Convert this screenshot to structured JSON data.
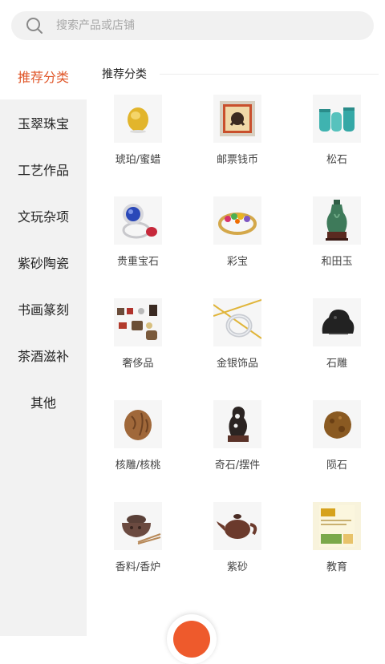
{
  "search": {
    "placeholder": "搜索产品或店铺"
  },
  "sidebar": {
    "active_color": "#e0572a",
    "items": [
      {
        "label": "推荐分类",
        "active": true
      },
      {
        "label": "玉翠珠宝"
      },
      {
        "label": "工艺作品"
      },
      {
        "label": "文玩杂项"
      },
      {
        "label": "紫砂陶瓷"
      },
      {
        "label": "书画篆刻"
      },
      {
        "label": "茶酒滋补"
      },
      {
        "label": "其他"
      }
    ]
  },
  "main": {
    "section_title": "推荐分类",
    "categories": [
      {
        "label": "琥珀/蜜蜡",
        "icon": "amber-icon"
      },
      {
        "label": "邮票钱币",
        "icon": "stamp-icon"
      },
      {
        "label": "松石",
        "icon": "turquoise-vases-icon"
      },
      {
        "label": "贵重宝石",
        "icon": "sapphire-ring-icon"
      },
      {
        "label": "彩宝",
        "icon": "gem-ring-icon"
      },
      {
        "label": "和田玉",
        "icon": "jade-vase-icon"
      },
      {
        "label": "奢侈品",
        "icon": "luxury-goods-icon"
      },
      {
        "label": "金银饰品",
        "icon": "silver-ring-icon"
      },
      {
        "label": "石雕",
        "icon": "stone-carving-icon"
      },
      {
        "label": "核雕/核桃",
        "icon": "walnut-icon"
      },
      {
        "label": "奇石/摆件",
        "icon": "rock-ornament-icon"
      },
      {
        "label": "陨石",
        "icon": "meteorite-icon"
      },
      {
        "label": "香料/香炉",
        "icon": "incense-burner-icon"
      },
      {
        "label": "紫砂",
        "icon": "teapot-icon"
      },
      {
        "label": "教育",
        "icon": "education-book-icon"
      }
    ]
  },
  "fab": {
    "color": "#ee5a2c"
  }
}
